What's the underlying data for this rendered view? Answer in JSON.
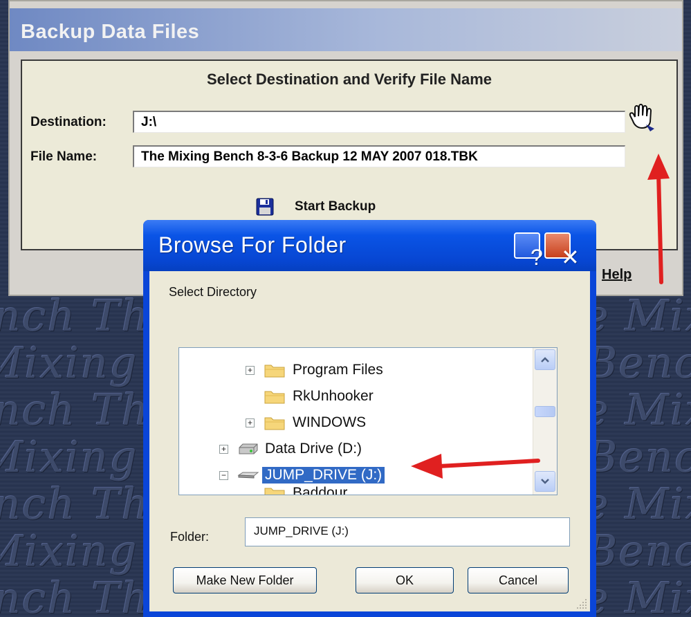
{
  "background": {
    "watermark_rows": [
      "Mixing Bench The Mixing Bench",
      "nch The Mixing Bench The Mix",
      "Mixing Bench The Mixing Bench",
      "nch The Mixing Bench The Mix",
      "Mixing Bench The Mixing Bench",
      "nch The Mixing Bench The Mix"
    ]
  },
  "backup_window": {
    "title": "Backup Data Files",
    "heading": "Select Destination and Verify File Name",
    "destination_label": "Destination:",
    "destination_value": "J:\\",
    "file_name_label": "File Name:",
    "file_name_value": "The Mixing Bench 8-3-6 Backup 12 MAY 2007  018.TBK",
    "start_backup_label": "Start Backup",
    "help_label": "Help",
    "browse_icon": "pointing-hand-icon",
    "start_icon": "floppy-disk-icon"
  },
  "browse_dialog": {
    "title": "Browse For Folder",
    "help_button": "?",
    "close_button": "✕",
    "instruction": "Select Directory",
    "tree": [
      {
        "label": "Program Files",
        "icon": "folder-icon",
        "expander": "+"
      },
      {
        "label": "RkUnhooker",
        "icon": "folder-icon",
        "expander": ""
      },
      {
        "label": "WINDOWS",
        "icon": "folder-icon",
        "expander": "+"
      },
      {
        "label": "Data Drive (D:)",
        "icon": "hard-drive-icon",
        "expander": "+"
      },
      {
        "label": "JUMP_DRIVE (J:)",
        "icon": "removable-drive-icon",
        "expander": "−",
        "selected": true
      },
      {
        "label": "Baddour",
        "icon": "folder-icon",
        "expander": ""
      }
    ],
    "folder_label": "Folder:",
    "folder_value": "JUMP_DRIVE (J:)",
    "buttons": {
      "make_new_folder": "Make New Folder",
      "ok": "OK",
      "cancel": "Cancel"
    }
  },
  "colors": {
    "selection": "#316ac5",
    "annotation_arrow": "#e02020",
    "xp_title_blue": "#0a54e6"
  }
}
